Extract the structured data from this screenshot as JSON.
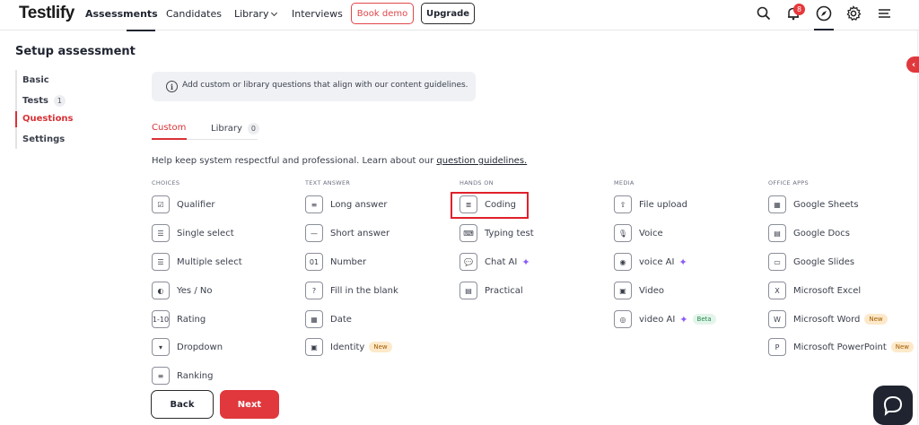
{
  "app": {
    "logo": "Testlify"
  },
  "nav": {
    "items": [
      {
        "label": "Assessments",
        "active": true
      },
      {
        "label": "Candidates"
      },
      {
        "label": "Library"
      },
      {
        "label": "Interviews"
      }
    ],
    "book_demo": "Book demo",
    "upgrade": "Upgrade",
    "notification_count": "8",
    "icons": [
      "search-icon",
      "bell-icon",
      "compass-icon",
      "gear-icon",
      "menu-icon"
    ]
  },
  "page": {
    "title": "Setup assessment"
  },
  "sidebar": {
    "items": [
      {
        "label": "Basic"
      },
      {
        "label": "Tests",
        "count": "1"
      },
      {
        "label": "Questions",
        "active": true
      },
      {
        "label": "Settings"
      }
    ]
  },
  "info": {
    "text": "Add custom or library questions that align with our content guidelines."
  },
  "tabs": {
    "custom": "Custom",
    "library": "Library",
    "library_count": "0"
  },
  "help": {
    "text": "Help keep system respectful and professional. Learn about our ",
    "link": "question guidelines."
  },
  "columns": [
    {
      "heading": "CHOICES",
      "items": [
        {
          "label": "Qualifier",
          "icon": "clipboard-check-icon",
          "glyph": "☑"
        },
        {
          "label": "Single select",
          "icon": "list-icon",
          "glyph": "☰"
        },
        {
          "label": "Multiple select",
          "icon": "checklist-icon",
          "glyph": "☰"
        },
        {
          "label": "Yes / No",
          "icon": "half-circle-icon",
          "glyph": "◐"
        },
        {
          "label": "Rating",
          "icon": "rating-scale-icon",
          "glyph": "1-10"
        },
        {
          "label": "Dropdown",
          "icon": "dropdown-icon",
          "glyph": "▾"
        },
        {
          "label": "Ranking",
          "icon": "ranking-icon",
          "glyph": "≡"
        }
      ]
    },
    {
      "heading": "TEXT ANSWER",
      "items": [
        {
          "label": "Long answer",
          "icon": "long-text-icon",
          "glyph": "≡"
        },
        {
          "label": "Short answer",
          "icon": "short-text-icon",
          "glyph": "—"
        },
        {
          "label": "Number",
          "icon": "number-icon",
          "glyph": "01"
        },
        {
          "label": "Fill in the blank",
          "icon": "fill-blank-icon",
          "glyph": "?"
        },
        {
          "label": "Date",
          "icon": "calendar-icon",
          "glyph": "▦"
        },
        {
          "label": "Identity",
          "icon": "id-card-icon",
          "glyph": "▣",
          "tag": "New"
        }
      ]
    },
    {
      "heading": "HANDS ON",
      "items": [
        {
          "label": "Coding",
          "icon": "code-icon",
          "glyph": "≣",
          "highlighted": true
        },
        {
          "label": "Typing test",
          "icon": "keyboard-icon",
          "glyph": "⌨"
        },
        {
          "label": "Chat AI",
          "icon": "chat-icon",
          "glyph": "💬",
          "sparkle": true
        },
        {
          "label": "Practical",
          "icon": "practical-icon",
          "glyph": "▤"
        }
      ]
    },
    {
      "heading": "MEDIA",
      "items": [
        {
          "label": "File upload",
          "icon": "file-upload-icon",
          "glyph": "⇧"
        },
        {
          "label": "Voice",
          "icon": "microphone-icon",
          "glyph": "🎙"
        },
        {
          "label": "voice AI",
          "icon": "voice-ai-icon",
          "glyph": "◉",
          "sparkle": true
        },
        {
          "label": "Video",
          "icon": "video-icon",
          "glyph": "▣"
        },
        {
          "label": "video AI",
          "icon": "video-ai-icon",
          "glyph": "◎",
          "sparkle": true,
          "tag": "Beta"
        }
      ]
    },
    {
      "heading": "OFFICE APPS",
      "items": [
        {
          "label": "Google Sheets",
          "icon": "google-sheets-icon",
          "glyph": "▦"
        },
        {
          "label": "Google Docs",
          "icon": "google-docs-icon",
          "glyph": "▤"
        },
        {
          "label": "Google Slides",
          "icon": "google-slides-icon",
          "glyph": "▭"
        },
        {
          "label": "Microsoft Excel",
          "icon": "excel-icon",
          "glyph": "X"
        },
        {
          "label": "Microsoft Word",
          "icon": "word-icon",
          "glyph": "W",
          "tag": "New"
        },
        {
          "label": "Microsoft PowerPoint",
          "icon": "powerpoint-icon",
          "glyph": "P",
          "tag": "New"
        }
      ]
    }
  ],
  "footer": {
    "back": "Back",
    "next": "Next"
  },
  "misc": {
    "collapse": "‹"
  }
}
